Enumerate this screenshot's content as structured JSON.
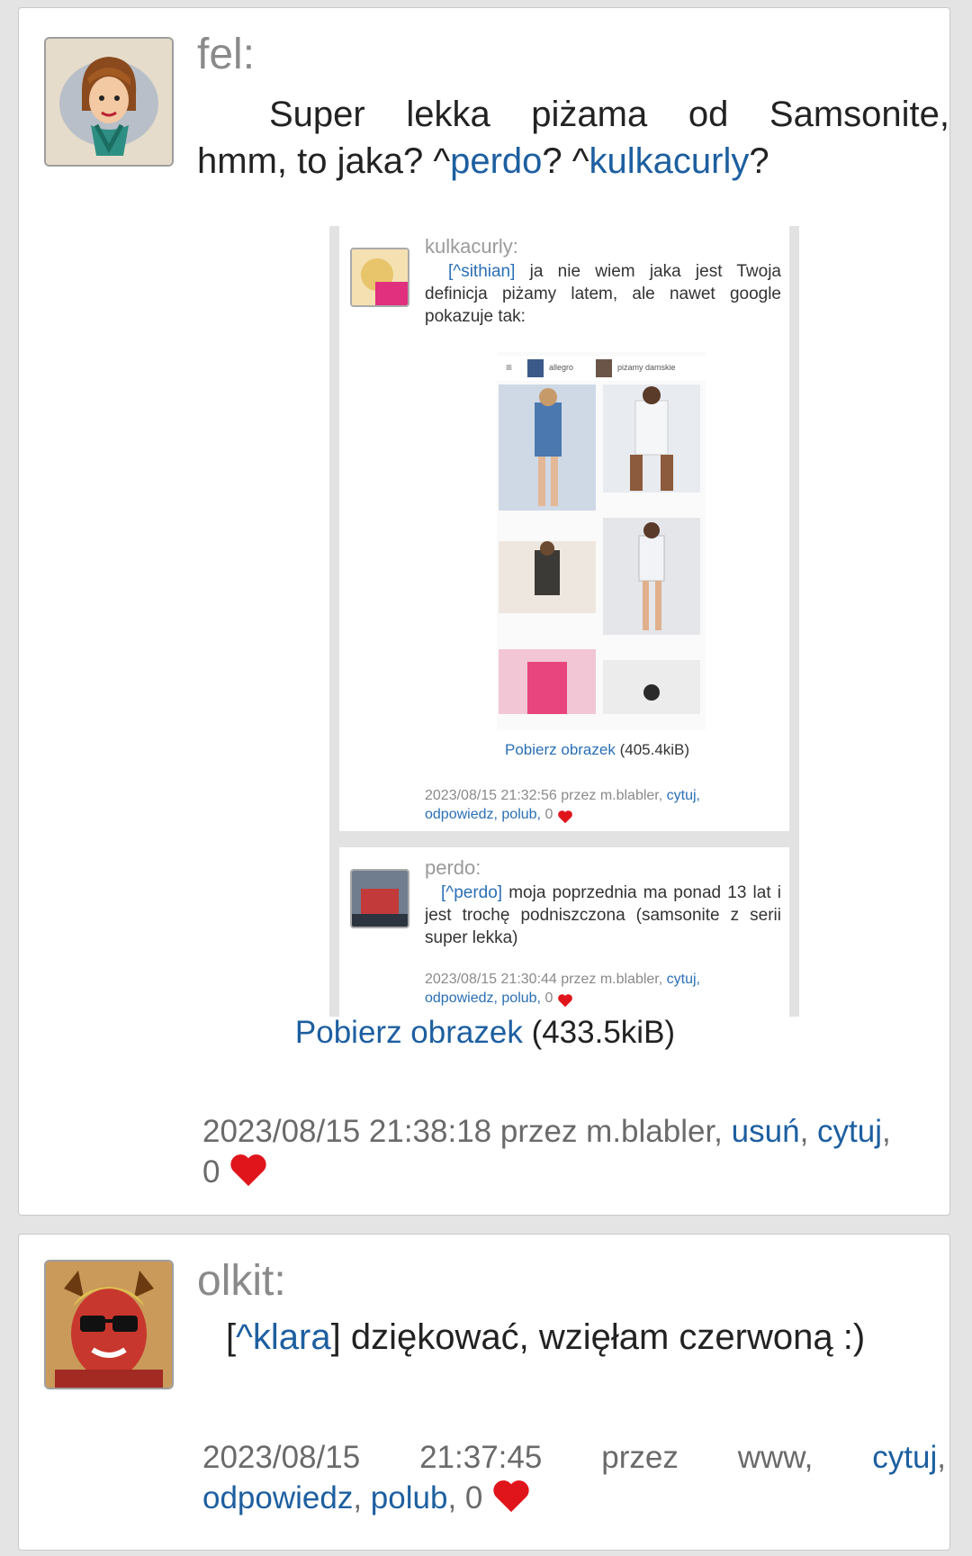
{
  "posts": [
    {
      "author": "fel:",
      "text_prefix": "Super lekka piżama od Samsonite, hmm, to jaka? ^",
      "mention1": "perdo",
      "text_mid": "? ^",
      "mention2": "kulkacurly",
      "text_suffix": "?",
      "image": {
        "card1": {
          "author": "kulkacurly:",
          "mention": "[^sithian]",
          "text": "ja nie wiem jaka jest Twoja definicja piżamy latem, ale nawet google pokazuje tak:",
          "search_chip1": "allegro",
          "search_chip2": "piżamy damskie",
          "download_link": "Pobierz obrazek",
          "download_size": "(405.4kiB)",
          "meta_date": "2023/08/15 21:32:56 przez m.blabler,",
          "meta_quote": "cytuj,",
          "meta_reply": "odpowiedz,",
          "meta_like": "polub,",
          "meta_count": "0"
        },
        "card2": {
          "author": "perdo:",
          "mention": "[^perdo]",
          "text": "moja poprzednia ma ponad 13 lat i jest trochę podniszczona (samsonite z serii super lekka)",
          "meta_date": "2023/08/15 21:30:44 przez m.blabler,",
          "meta_quote": "cytuj,",
          "meta_reply": "odpowiedz,",
          "meta_like": "polub,",
          "meta_count": "0"
        }
      },
      "download_link": "Pobierz obrazek",
      "download_size": "(433.5kiB)",
      "meta_date": "2023/08/15 21:38:18 przez m.blabler,",
      "delete": "usuń",
      "quote": "cytuj",
      "likes": "0"
    },
    {
      "author": "olkit:",
      "mention": "^klara",
      "text": "dziękować, wzięłam czerwoną :)",
      "meta_date": "2023/08/15",
      "meta_time": "21:37:45",
      "meta_by": "przez",
      "meta_user": "www,",
      "quote": "cytuj",
      "reply": "odpowiedz",
      "like": "polub",
      "likes": "0"
    }
  ],
  "colors": {
    "link": "#1d5fa0",
    "heart": "#e0151b",
    "meta": "#6a6a6a"
  }
}
